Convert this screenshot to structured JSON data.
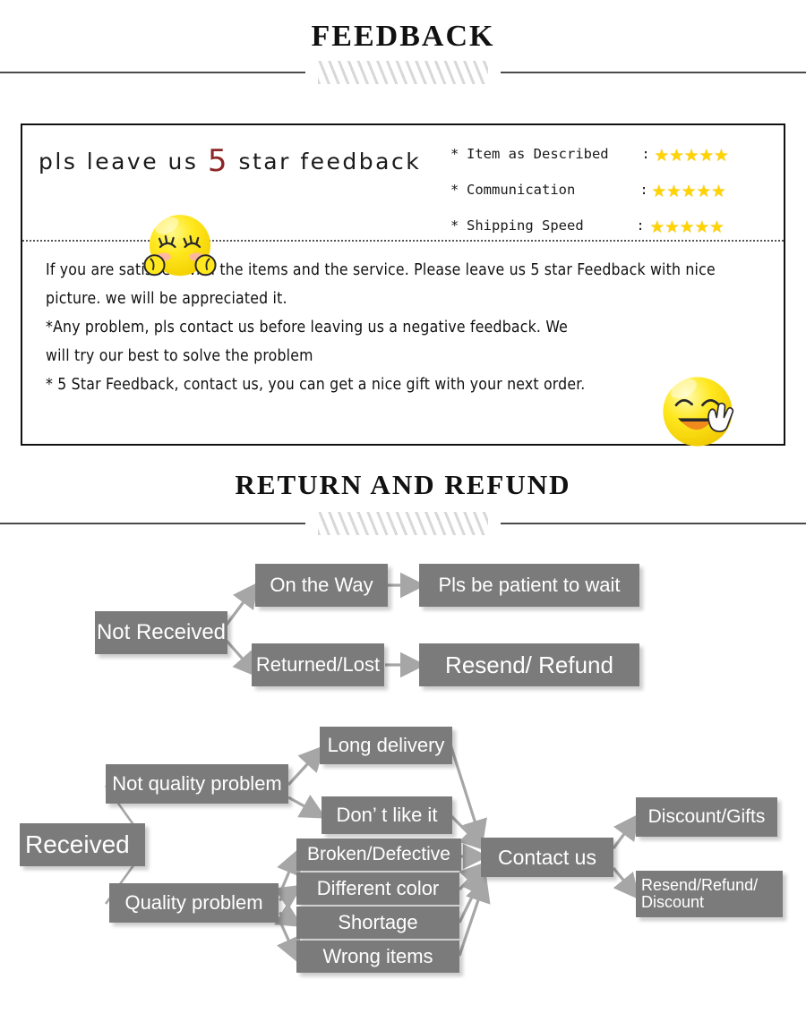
{
  "sections": {
    "feedback": {
      "title": "FEEDBACK"
    },
    "return": {
      "title": "RETURN  AND  REFUND"
    }
  },
  "feedback_box": {
    "headline": {
      "before": "pls leave us ",
      "number": "5",
      "after": " star feedback"
    },
    "ratings": [
      {
        "bullet": "*",
        "label": "Item as Described",
        "colon": ":",
        "stars": "★★★★★",
        "value": 5
      },
      {
        "bullet": "*",
        "label": "Communication",
        "colon": ":",
        "stars": "★★★★★",
        "value": 5
      },
      {
        "bullet": "*",
        "label": "Shipping Speed",
        "colon": ":",
        "stars": "★★★★★",
        "value": 5
      }
    ],
    "body_lines": [
      "If you are satisfied with the items and the service. Please leave us 5 star Feedback with nice",
      "picture. we will be appreciated it.",
      "*Any problem, pls contact us before leaving us a negative feedback. We",
      "will try our best to solve  the problem",
      "* 5 Star Feedback, contact us, you can get a nice gift with your next order."
    ],
    "emojis": [
      {
        "name": "shy-blushing-face-emoji"
      },
      {
        "name": "smiling-face-with-peace-sign-emoji"
      }
    ]
  },
  "flowchart": {
    "nodes": {
      "not_received": "Not Received",
      "on_the_way": "On the Way",
      "pls_be_patient": "Pls be patient to wait",
      "returned_lost": "Returned/Lost",
      "resend_refund": "Resend/ Refund",
      "received": "Received",
      "not_quality": "Not quality problem",
      "quality": "Quality problem",
      "long_delivery": "Long delivery",
      "dont_like": "Don’  t like it",
      "broken": "Broken/Defective",
      "different_color": "Different color",
      "shortage": "Shortage",
      "wrong_items": "Wrong items",
      "contact_us": "Contact us",
      "discount_gifts": "Discount/Gifts",
      "resend_refund_disc": "Resend/Refund/\nDiscount"
    }
  },
  "colors": {
    "node_fill": "#7b7b7b",
    "node_text": "#ffffff",
    "star": "#ffd400",
    "accent_red": "#8d2626",
    "rule": "#4a4a4a",
    "hatch": "#d8d8d8"
  }
}
